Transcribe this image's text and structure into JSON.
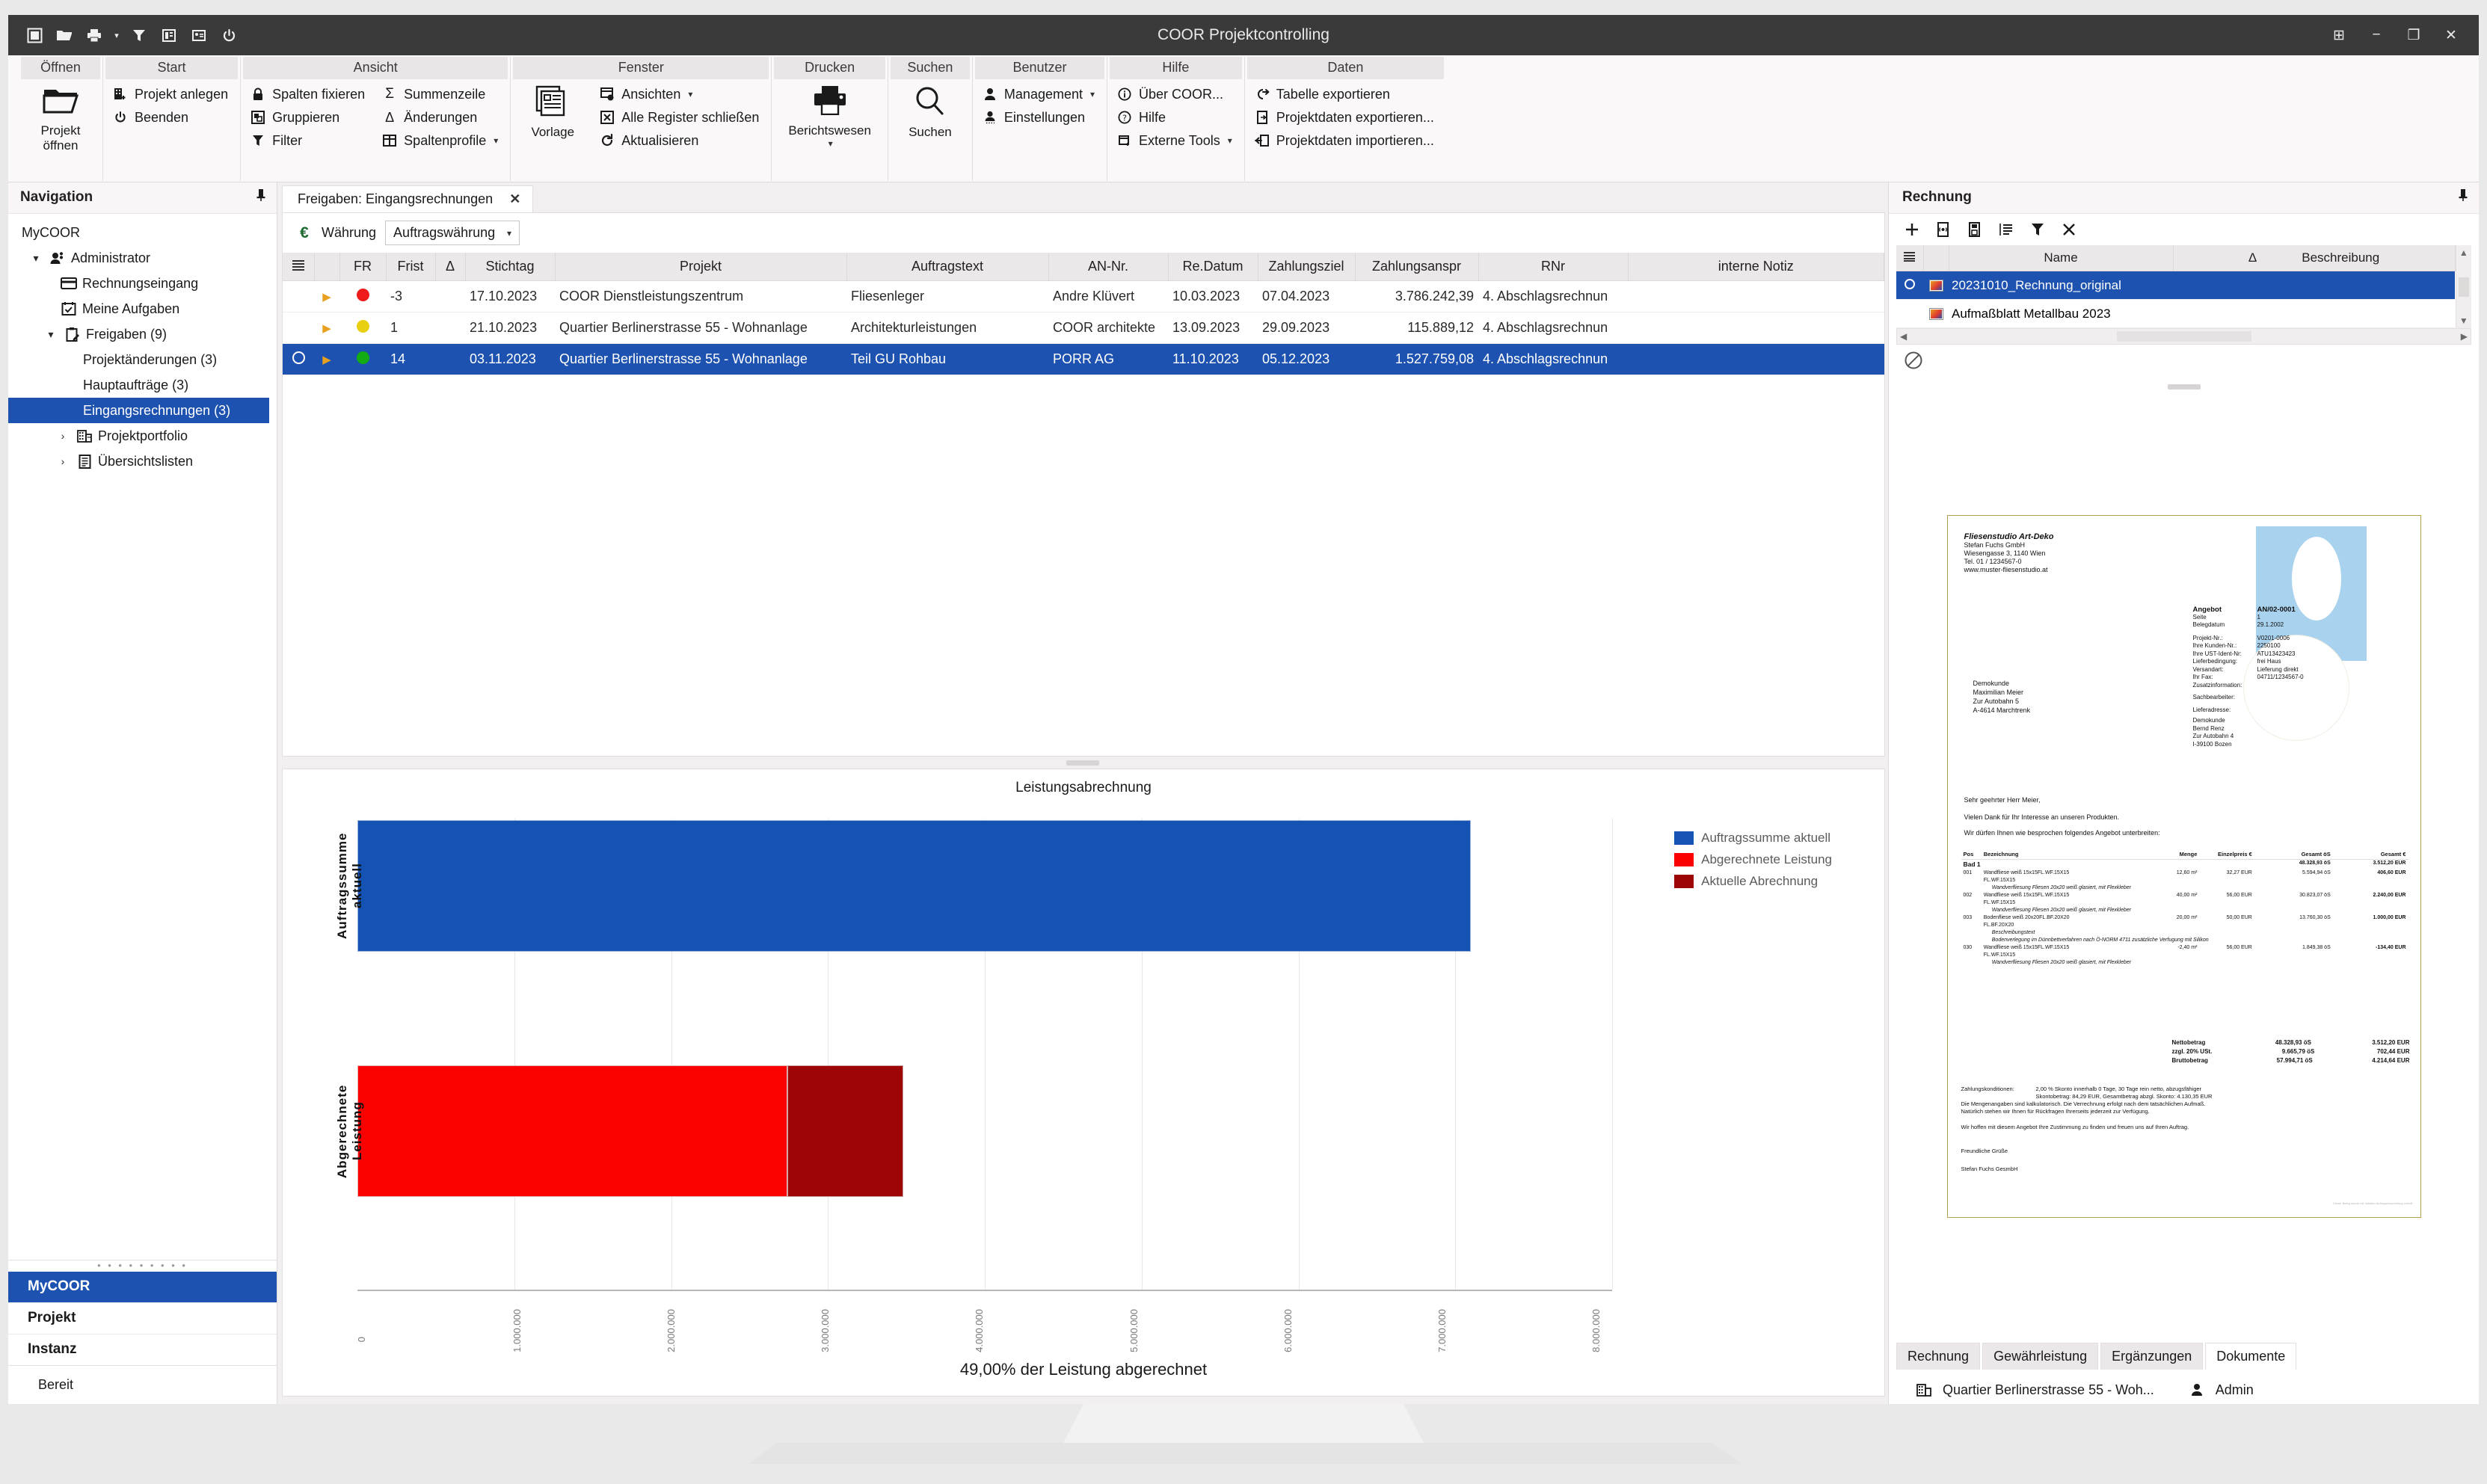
{
  "window": {
    "title": "COOR Projektcontrolling",
    "quick_access": [
      "stop-icon",
      "open-folder-icon",
      "print-icon",
      "filter-icon",
      "report-icon",
      "card-icon",
      "power-icon"
    ],
    "buttons": {
      "restore_down": "⊞",
      "minimize": "−",
      "maximize": "❐",
      "close": "✕"
    }
  },
  "ribbon": {
    "groups": [
      {
        "title": "Öffnen",
        "big": [
          {
            "label1": "Projekt",
            "label2": "öffnen",
            "icon": "open-folder-icon"
          }
        ],
        "items": []
      },
      {
        "title": "Start",
        "big": [],
        "items": [
          {
            "label": "Projekt anlegen",
            "icon": "building-plus-icon",
            "caret": false
          },
          {
            "label": "Beenden",
            "icon": "power-icon",
            "caret": false
          }
        ]
      },
      {
        "title": "Ansicht",
        "big": [],
        "columns": [
          [
            {
              "label": "Spalten fixieren",
              "icon": "lock-icon",
              "caret": false
            },
            {
              "label": "Gruppieren",
              "icon": "group-icon",
              "caret": false
            },
            {
              "label": "Filter",
              "icon": "filter-icon",
              "caret": false
            }
          ],
          [
            {
              "label": "Summenzeile",
              "icon": "sigma-icon",
              "caret": false
            },
            {
              "label": "Änderungen",
              "icon": "delta-icon",
              "caret": false
            },
            {
              "label": "Spaltenprofile",
              "icon": "table-icon",
              "caret": true
            }
          ]
        ]
      },
      {
        "title": "Fenster",
        "big": [
          {
            "label1": "Vorlage",
            "label2": "",
            "icon": "documents-icon"
          }
        ],
        "items": [
          {
            "label": "Ansichten",
            "icon": "views-icon",
            "caret": true
          },
          {
            "label": "Alle Register schließen",
            "icon": "close-box-icon",
            "caret": false
          },
          {
            "label": "Aktualisieren",
            "icon": "refresh-icon",
            "caret": false
          }
        ]
      },
      {
        "title": "Drucken",
        "big": [
          {
            "label1": "Berichtswesen",
            "label2": "▾",
            "icon": "printer-icon"
          }
        ],
        "items": []
      },
      {
        "title": "Suchen",
        "big": [
          {
            "label1": "Suchen",
            "label2": "",
            "icon": "magnifier-icon"
          }
        ],
        "items": []
      },
      {
        "title": "Benutzer",
        "big": [],
        "items": [
          {
            "label": "Management",
            "icon": "user-icon",
            "caret": true
          },
          {
            "label": "Einstellungen",
            "icon": "user-gear-icon",
            "caret": false
          }
        ]
      },
      {
        "title": "Hilfe",
        "big": [],
        "items": [
          {
            "label": "Über COOR...",
            "icon": "info-icon",
            "caret": false
          },
          {
            "label": "Hilfe",
            "icon": "question-icon",
            "caret": false
          },
          {
            "label": "Externe Tools",
            "icon": "tools-icon",
            "caret": true
          }
        ]
      },
      {
        "title": "Daten",
        "big": [],
        "items": [
          {
            "label": "Tabelle exportieren",
            "icon": "export-table-icon",
            "caret": false
          },
          {
            "label": "Projektdaten exportieren...",
            "icon": "export-doc-icon",
            "caret": false
          },
          {
            "label": "Projektdaten importieren...",
            "icon": "import-doc-icon",
            "caret": false
          }
        ]
      }
    ]
  },
  "navigation": {
    "header": "Navigation",
    "pin_icon": "pin-icon",
    "root": "MyCOOR",
    "items": [
      {
        "label": "Administrator",
        "level": 1,
        "twisty": "▾",
        "icon": "users-icon",
        "selected": false
      },
      {
        "label": "Rechnungseingang",
        "level": 2,
        "twisty": "",
        "icon": "card-icon",
        "selected": false
      },
      {
        "label": "Meine Aufgaben",
        "level": 2,
        "twisty": "",
        "icon": "task-icon",
        "selected": false
      },
      {
        "label": "Freigaben (9)",
        "level": 2,
        "twisty": "▾",
        "icon": "clipboard-icon",
        "selected": false
      },
      {
        "label": "Projektänderungen (3)",
        "level": 3,
        "twisty": "",
        "icon": "",
        "selected": false
      },
      {
        "label": "Hauptaufträge (3)",
        "level": 3,
        "twisty": "",
        "icon": "",
        "selected": false
      },
      {
        "label": "Eingangsrechnungen (3)",
        "level": 3,
        "twisty": "",
        "icon": "",
        "selected": true
      },
      {
        "label": "Projektportfolio",
        "level": 1,
        "twisty": "›",
        "icon": "buildings-icon",
        "selected": false
      },
      {
        "label": "Übersichtslisten",
        "level": 1,
        "twisty": "›",
        "icon": "list-doc-icon",
        "selected": false
      }
    ],
    "tabs": [
      {
        "label": "MyCOOR",
        "selected": true
      },
      {
        "label": "Projekt",
        "selected": false
      },
      {
        "label": "Instanz",
        "selected": false
      }
    ],
    "status": "Bereit"
  },
  "center": {
    "document_tab": {
      "label": "Freigaben: Eingangsrechnungen",
      "close": "✕"
    },
    "toolbar": {
      "currency_icon": "euro-icon",
      "currency_label": "Währung",
      "currency_value": "Auftragswährung",
      "caret": "▾"
    },
    "grid": {
      "columns": [
        "",
        "",
        "FR",
        "Frist",
        "Δ",
        "Stichtag",
        "Projekt",
        "Auftragstext",
        "AN-Nr.",
        "Re.Datum",
        "Zahlungsziel",
        "Zahlungsanspr",
        "RNr",
        "interne Notiz"
      ],
      "rows": [
        {
          "marker": "",
          "expander": "▶",
          "fr_color": "#f01c1c",
          "frist": "-3",
          "delta": "",
          "stichtag": "17.10.2023",
          "projekt": "COOR Dienstleistungszentrum",
          "auftragstext": "Fliesenleger",
          "an_nr": "Andre Klüvert",
          "re_datum": "10.03.2023",
          "zahlungsziel": "07.04.2023",
          "zahlungsanspr": "3.786.242,39",
          "rnr": "4. Abschlagsrechnun",
          "notiz": "",
          "selected": false
        },
        {
          "marker": "",
          "expander": "▶",
          "fr_color": "#e8cf12",
          "frist": "1",
          "delta": "",
          "stichtag": "21.10.2023",
          "projekt": "Quartier Berlinerstrasse 55 - Wohnanlage",
          "auftragstext": "Architekturleistungen",
          "an_nr": "COOR architekte",
          "re_datum": "13.09.2023",
          "zahlungsziel": "29.09.2023",
          "zahlungsanspr": "115.889,12",
          "rnr": "4. Abschlagsrechnun",
          "notiz": "",
          "selected": false
        },
        {
          "marker": "○",
          "expander": "▶",
          "fr_color": "#13ac13",
          "frist": "14",
          "delta": "",
          "stichtag": "03.11.2023",
          "projekt": "Quartier Berlinerstrasse 55 - Wohnanlage",
          "auftragstext": "Teil GU Rohbau",
          "an_nr": "PORR AG",
          "re_datum": "11.10.2023",
          "zahlungsziel": "05.12.2023",
          "zahlungsanspr": "1.527.759,08",
          "rnr": "4. Abschlagsrechnun",
          "notiz": "",
          "selected": true
        }
      ]
    }
  },
  "chart_data": {
    "type": "bar",
    "orientation": "horizontal",
    "stacked": true,
    "title": "Leistungsabrechnung",
    "footer": "49,00% der Leistung abgerechnet",
    "categories": [
      "Auftragssumme aktuell",
      "Abgerechnete Leistung"
    ],
    "series": [
      {
        "name": "Auftragssumme aktuell",
        "color": "#1453b4",
        "values": [
          7100000,
          0
        ]
      },
      {
        "name": "Abgerechnete Leistung",
        "color": "#fa0000",
        "values": [
          0,
          2740000
        ]
      },
      {
        "name": "Aktuelle Abrechnung",
        "color": "#9c0606",
        "values": [
          0,
          740000
        ]
      }
    ],
    "legend": [
      {
        "label": "Auftragssumme aktuell",
        "color": "#1453b4"
      },
      {
        "label": "Abgerechnete Leistung",
        "color": "#fa0000"
      },
      {
        "label": "Aktuelle Abrechnung",
        "color": "#9c0606"
      }
    ],
    "legend_position": "right",
    "xlabel": "",
    "ylabel": "",
    "xlim": [
      0,
      8000000
    ],
    "xticks": [
      0,
      1000000,
      2000000,
      3000000,
      4000000,
      5000000,
      6000000,
      7000000,
      8000000
    ],
    "xticklabels": [
      "0",
      "1.000.000",
      "2.000.000",
      "3.000.000",
      "4.000.000",
      "5.000.000",
      "6.000.000",
      "7.000.000",
      "8.000.000"
    ],
    "grid": true
  },
  "right_panel": {
    "header": "Rechnung",
    "pin_icon": "pin-icon",
    "toolbar": [
      "plus-icon",
      "document-link-icon",
      "document-save-icon",
      "list-icon",
      "filter-icon",
      "close-icon"
    ],
    "list": {
      "columns": [
        "",
        "Name",
        "Δ",
        "Beschreibung"
      ],
      "rows": [
        {
          "marker": "○",
          "icon": "image-file-icon",
          "name": "20231010_Rechnung_original",
          "beschreibung": "",
          "selected": true
        },
        {
          "marker": "",
          "icon": "image-file-icon",
          "name": "Aufmaßblatt Metallbau 2023",
          "beschreibung": "",
          "selected": false
        }
      ]
    },
    "no_drop_icon": "no-drop-icon",
    "tabs": [
      {
        "label": "Rechnung",
        "selected": false
      },
      {
        "label": "Gewährleistung",
        "selected": false
      },
      {
        "label": "Ergänzungen",
        "selected": false
      },
      {
        "label": "Dokumente",
        "selected": true
      }
    ],
    "status": {
      "project_icon": "buildings-icon",
      "project": "Quartier Berlinerstrasse 55 - Woh...",
      "user_icon": "user-icon",
      "user": "Admin"
    }
  },
  "document_preview": {
    "sender": {
      "name": "Fliesenstudio Art-Deko",
      "lines": [
        "Stefan Fuchs GmbH",
        "Wiesengasse 3, 1140 Wien",
        "Tel. 01 / 1234567-0",
        "www.muster-fliesenstudio.at"
      ]
    },
    "recipient": [
      "Demokunde",
      "Maximilian Meier",
      "Zur Autobahn 5",
      "A-4614 Marchtrenk"
    ],
    "meta_head": [
      {
        "k": "Angebot",
        "v": "AN/02-0001"
      },
      {
        "k": "Seite",
        "v": "1"
      },
      {
        "k": "Belegdatum",
        "v": "29.1.2002"
      }
    ],
    "meta": [
      {
        "k": "Projekt-Nr.:",
        "v": "V0201-0006"
      },
      {
        "k": "Ihre Kunden-Nr.:",
        "v": "2250100"
      },
      {
        "k": "Ihre UST-Ident-Nr:",
        "v": "ATU13423423"
      },
      {
        "k": "Lieferbedingung:",
        "v": "frei Haus"
      },
      {
        "k": "Versandart:",
        "v": "Lieferung direkt"
      },
      {
        "k": "Ihr Fax:",
        "v": "04711/1234567-0"
      },
      {
        "k": "Zusatzinformation:",
        "v": ""
      }
    ],
    "meta2_label": "Sachbearbeiter:",
    "delivery_label": "Lieferadresse:",
    "delivery": [
      "Demokunde",
      "Bernd Renz",
      "Zur Autobahn 4",
      "I-39100 Bozen"
    ],
    "salutation": "Sehr geehrter Herr Meier,",
    "intro": [
      "Vielen Dank für Ihr Interesse an unseren Produkten.",
      "Wir dürfen Ihnen wie besprochen folgendes Angebot unterbreiten:"
    ],
    "table_head": [
      "Pos",
      "Bezeichnung",
      "Menge",
      "Einzelpreis €",
      "Gesamt öS",
      "Gesamt €"
    ],
    "group": {
      "label": "Bad 1",
      "gesamt_os": "48.328,93  öS",
      "gesamt_eur": "3.512,20 EUR"
    },
    "positions": [
      {
        "pos": "001",
        "bez": "Wandfliese weiß 15x15FL.WF.15X15",
        "sub": "FL.WF.15X15",
        "desc": "Wandverfliesung Fliesen 20x20 weiß glasiert, mit Flexkleber",
        "menge": "12,60 m²",
        "einzel": "32,27  EUR",
        "gesamt_os": "5.594,94 öS",
        "gesamt_eur": "406,60 EUR"
      },
      {
        "pos": "002",
        "bez": "Wandfliese weiß 15x15FL.WF.15X15",
        "sub": "FL.WF.15X15",
        "desc": "Wandverfliesung Fliesen 20x20 weiß glasiert, mit Flexkleber",
        "menge": "40,00 m²",
        "einzel": "56,00  EUR",
        "gesamt_os": "30.823,07 öS",
        "gesamt_eur": "2.240,00 EUR"
      },
      {
        "pos": "003",
        "bez": "Bodenfliese weiß 20x20FL.BF.20X20",
        "sub": "FL.BF.20X20",
        "desc": "Beschreibungstext",
        "desc2": "Bodenverlegung im Dünnbettverfahren nach Ö-NORM 4711 zusätzliche Verfugung mit Silikon",
        "menge": "20,00 m²",
        "einzel": "50,00  EUR",
        "gesamt_os": "13.760,30 öS",
        "gesamt_eur": "1.000,00 EUR"
      },
      {
        "pos": "030",
        "bez": "Wandfliese weiß 15x15FL.WF.15X15",
        "sub": "FL.WF.15X15",
        "desc": "Wandverfliesung Fliesen 20x20 weiß glasiert, mit Flexkleber",
        "menge": "-2,40 m²",
        "einzel": "56,00  EUR",
        "gesamt_os": "1.849,38 öS",
        "gesamt_eur": "-134,40 EUR"
      }
    ],
    "totals": [
      {
        "k": "Nettobetrag",
        "os": "48.328,93 öS",
        "eur": "3.512,20 EUR"
      },
      {
        "k": "zzgl. 20% USt.",
        "os": "9.665,79 öS",
        "eur": "702,44 EUR"
      },
      {
        "k": "Bruttobetrag",
        "os": "57.994,71 öS",
        "eur": "4.214,64 EUR"
      }
    ],
    "terms_label": "Zahlungskonditionen:",
    "terms": "2,00 % Skonto innerhalb 0 Tage, 30 Tage rein netto, abzugsfähiger",
    "terms2": "Skontobetrag:          84,29 EUR, Gesamtbetrag abzgl. Skonto:     4.130,35 EUR",
    "notes": [
      "Die Mengenangaben sind kalkulatorisch. Die Verrechnung erfolgt nach dem tatsächlichen Aufmaß.",
      "Natürlich stehen wir Ihnen für Rückfragen Ihrerseits jederzeit zur Verfügung.",
      "Wir hoffen mit diesem Angebot Ihre Zustimmung zu finden und freuen uns auf Ihren Auftrag."
    ],
    "closing": "Freundliche Grüße",
    "signature": "Stefan Fuchs GesmbH",
    "stamp": "Dieser Beleg wurde mit Validato Auftragsbearbeitung erstellt"
  }
}
